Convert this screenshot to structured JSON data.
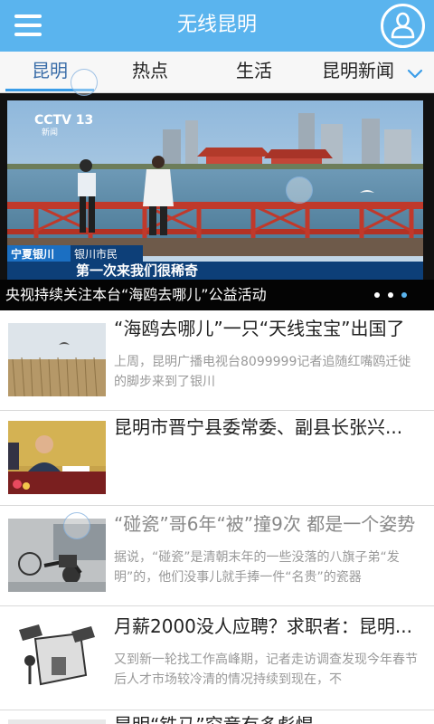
{
  "header": {
    "title": "无线昆明",
    "menu_icon": "hamburger-menu-icon",
    "user_icon": "user-avatar-icon"
  },
  "tabs": {
    "items": [
      {
        "label": "昆明",
        "active": true
      },
      {
        "label": "热点",
        "active": false
      },
      {
        "label": "生活",
        "active": false
      },
      {
        "label": "昆明新闻",
        "active": false
      }
    ],
    "more_icon": "chevron-down-icon"
  },
  "banner": {
    "caption": "央视持续关注本台“海鸥去哪儿”公益活动",
    "image_texts": {
      "tv_logo": "CCTV 13",
      "tv_logo_sub": "新闻",
      "location_left": "宁夏银川",
      "location_right": "银川市民",
      "subtitle": "第一次来我们很稀奇"
    },
    "slide_count": 3,
    "active_slide": 3
  },
  "news": [
    {
      "title": "“海鸥去哪儿”一只“天线宝宝”出国了",
      "summary": "上周，昆明广播电视台8099999记者追随红嘴鸥迁徙的脚步来到了银川",
      "read": false
    },
    {
      "title": "昆明市晋宁县委常委、副县长张兴...",
      "summary": "",
      "read": false
    },
    {
      "title": "“碰瓷”哥6年“被”撞9次 都是一个姿势",
      "summary": "据说，“碰瓷”是清朝末年的一些没落的八旗子弟“发明”的，他们没事儿就手捧一件“名贵”的瓷器",
      "read": true
    },
    {
      "title": "月薪2000没人应聘？求职者：昆明...",
      "summary": "又到新一轮找工作高峰期，记者走访调查发现今年春节后人才市场较冷清的情况持续到现在，不",
      "read": false
    },
    {
      "title": "昆明“铁马”究竟有多彪悍",
      "summary": "",
      "read": false
    }
  ],
  "colors": {
    "header_bg": "#5ab4ee",
    "active_tab": "#3a6da8",
    "tab_underline": "#3a9de8",
    "read_title": "#888888"
  }
}
